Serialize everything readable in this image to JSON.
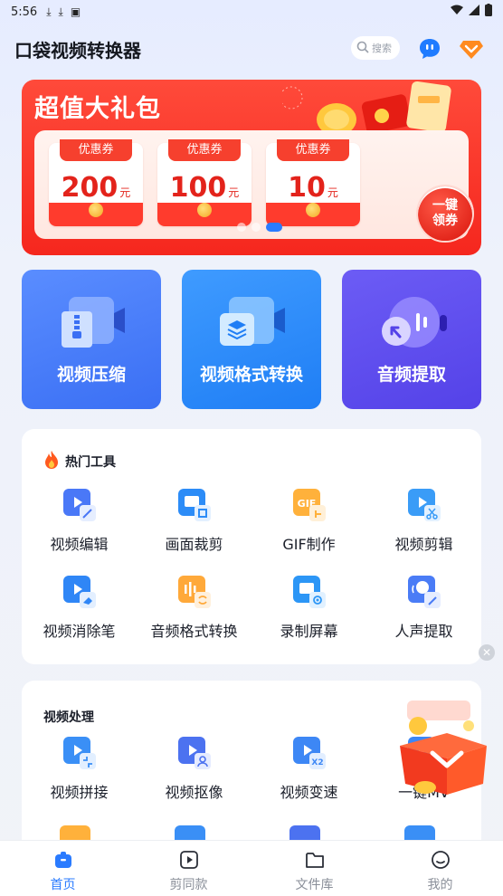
{
  "status_bar": {
    "time": "5:56"
  },
  "header": {
    "title": "口袋视频转换器",
    "search_placeholder": "搜索"
  },
  "banner": {
    "title": "超值大礼包",
    "coupons": [
      {
        "tag": "优惠券",
        "amount": "200",
        "unit": "元"
      },
      {
        "tag": "优惠券",
        "amount": "100",
        "unit": "元"
      },
      {
        "tag": "优惠券",
        "amount": "10",
        "unit": "元"
      }
    ],
    "claim_label_line1": "一键",
    "claim_label_line2": "领券"
  },
  "features": [
    {
      "label": "视频压缩"
    },
    {
      "label": "视频格式转换"
    },
    {
      "label": "音频提取"
    }
  ],
  "hot_tools": {
    "title": "热门工具",
    "items": [
      {
        "label": "视频编辑"
      },
      {
        "label": "画面裁剪"
      },
      {
        "label": "GIF制作"
      },
      {
        "label": "视频剪辑"
      },
      {
        "label": "视频消除笔"
      },
      {
        "label": "音频格式转换"
      },
      {
        "label": "录制屏幕"
      },
      {
        "label": "人声提取"
      }
    ]
  },
  "video_processing": {
    "title": "视频处理",
    "items": [
      {
        "label": "视频拼接"
      },
      {
        "label": "视频抠像"
      },
      {
        "label": "视频变速"
      },
      {
        "label": "一键MV"
      }
    ]
  },
  "bottom_nav": [
    {
      "label": "首页"
    },
    {
      "label": "剪同款"
    },
    {
      "label": "文件库"
    },
    {
      "label": "我的"
    }
  ],
  "colors": {
    "accent": "#2a7bff",
    "banner_red": "#f5271e"
  }
}
